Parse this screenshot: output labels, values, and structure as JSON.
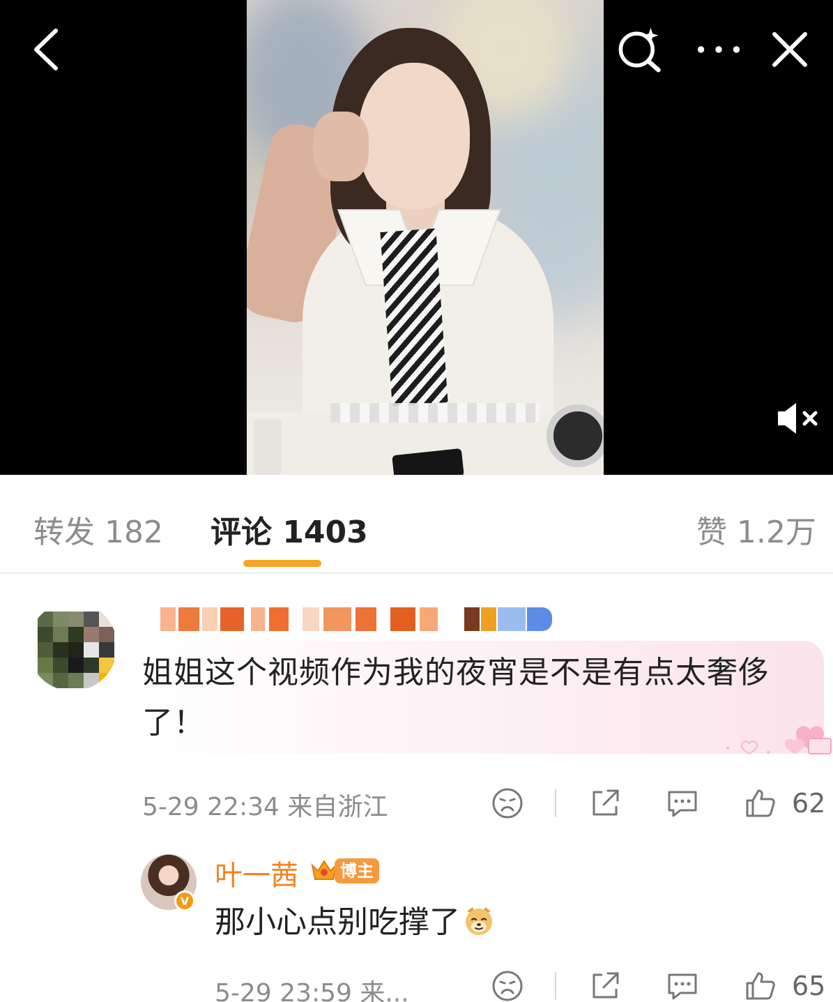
{
  "video": {
    "icons": {
      "back": "chevron-left-icon",
      "search": "sparkle-search-icon",
      "more": "more-dots-icon",
      "close": "close-icon",
      "mute": "muted-speaker-icon"
    }
  },
  "tabs": [
    {
      "label": "转发 182",
      "active": false
    },
    {
      "label": "评论 1403",
      "active": true
    },
    {
      "label": "赞 1.2万",
      "active": false
    }
  ],
  "accent_color": "#f6a623",
  "comments": [
    {
      "text": "姐姐这个视频作为我的夜宵是不是有点太奢侈了！",
      "meta": "5-29 22:34  来自浙江",
      "like_count": "62"
    },
    {
      "author": "叶一茜",
      "author_tag": "博主",
      "text": "那小心点别吃撑了",
      "emoji": "doge-emoji",
      "meta": "5-29 23:59  来...",
      "like_count": "65",
      "name_color": "#f4821f"
    }
  ]
}
